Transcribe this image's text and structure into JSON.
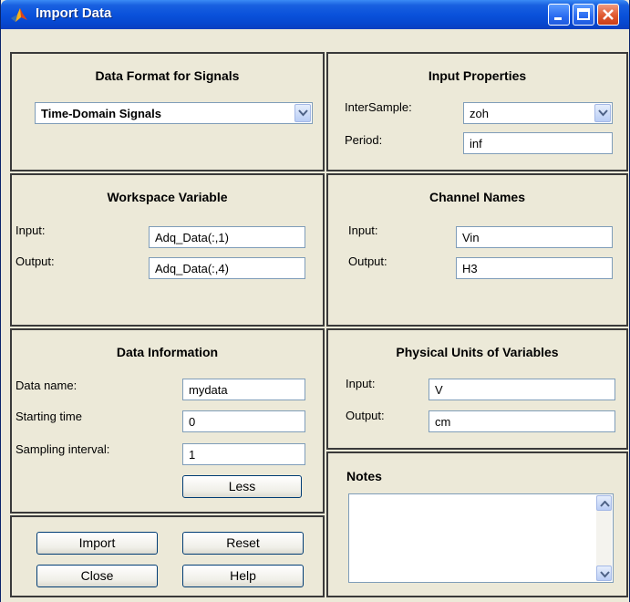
{
  "window": {
    "title": "Import Data"
  },
  "data_format": {
    "title": "Data Format for Signals",
    "selected": "Time-Domain Signals"
  },
  "input_properties": {
    "title": "Input Properties",
    "intersample_label": "InterSample:",
    "intersample_value": "zoh",
    "period_label": "Period:",
    "period_value": "inf"
  },
  "workspace_variable": {
    "title": "Workspace Variable",
    "input_label": "Input:",
    "input_value": "Adq_Data(:,1)",
    "output_label": "Output:",
    "output_value": "Adq_Data(:,4)"
  },
  "channel_names": {
    "title": "Channel Names",
    "input_label": "Input:",
    "input_value": "Vin",
    "output_label": "Output:",
    "output_value": "H3"
  },
  "data_information": {
    "title": "Data Information",
    "name_label": "Data name:",
    "name_value": "mydata",
    "start_label": "Starting time",
    "start_value": "0",
    "interval_label": "Sampling interval:",
    "interval_value": "1",
    "less_label": "Less"
  },
  "physical_units": {
    "title": "Physical Units of Variables",
    "input_label": "Input:",
    "input_value": "V",
    "output_label": "Output:",
    "output_value": "cm"
  },
  "notes": {
    "title": "Notes",
    "value": ""
  },
  "actions": {
    "import_label": "Import",
    "reset_label": "Reset",
    "close_label": "Close",
    "help_label": "Help"
  },
  "colors": {
    "titlebar": "#0a52db",
    "window_bg": "#ece9d8",
    "close_button": "#e05a30"
  }
}
